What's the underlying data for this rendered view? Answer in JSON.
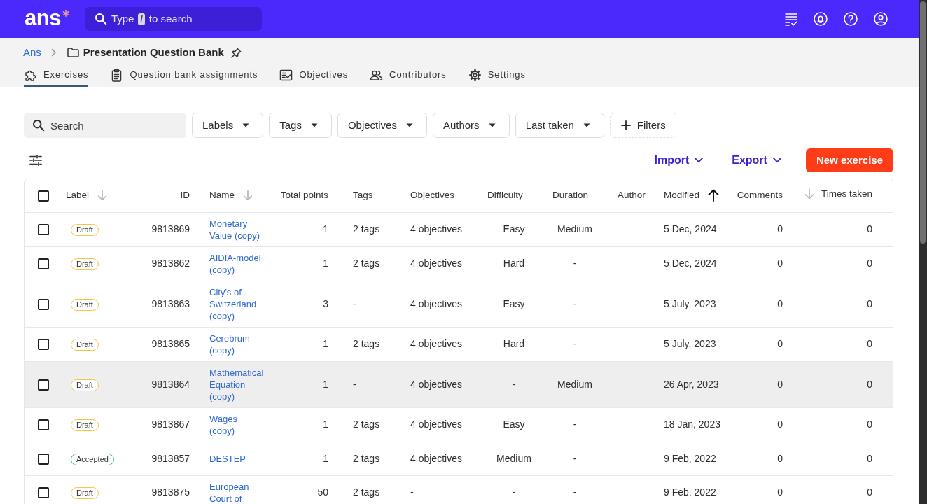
{
  "top_bar": {
    "logo": "ans",
    "search": {
      "hint_start": "Type",
      "shortcut": "/",
      "hint_end": "to search"
    }
  },
  "breadcrumb": {
    "root": "Ans",
    "current": "Presentation Question Bank"
  },
  "tabs": [
    {
      "label": "Exercises",
      "selected": true
    },
    {
      "label": "Question bank assignments",
      "selected": false
    },
    {
      "label": "Objectives",
      "selected": false
    },
    {
      "label": "Contributors",
      "selected": false
    },
    {
      "label": "Settings",
      "selected": false
    }
  ],
  "filters": {
    "search": {
      "placeholder": "Search"
    },
    "dropdowns": [
      "Labels",
      "Tags",
      "Objectives",
      "Authors",
      "Last taken"
    ],
    "add_filter": "Filters"
  },
  "actions": {
    "import": "Import",
    "export": "Export",
    "new_exercise": "New exercise"
  },
  "table": {
    "select_all": {
      "checked": false
    },
    "columns": [
      {
        "label": "Label",
        "sortable": true,
        "sorted": false
      },
      {
        "label": "ID",
        "sortable": false,
        "sorted": false
      },
      {
        "label": "Name",
        "sortable": true,
        "sorted": false
      },
      {
        "label": "Total points",
        "sortable": false,
        "sorted": false
      },
      {
        "label": "Tags",
        "sortable": false,
        "sorted": false
      },
      {
        "label": "Objectives",
        "sortable": false,
        "sorted": false
      },
      {
        "label": "Difficulty",
        "sortable": false,
        "sorted": false
      },
      {
        "label": "Duration",
        "sortable": false,
        "sorted": false
      },
      {
        "label": "Author",
        "sortable": false,
        "sorted": false
      },
      {
        "label": "Modified",
        "sortable": true,
        "sorted": true
      },
      {
        "label": "Comments",
        "sortable": false,
        "sorted": false
      },
      {
        "label": "Times taken",
        "sortable": true,
        "sorted": false
      }
    ],
    "rows": [
      {
        "checked": false,
        "hovered": false,
        "label": {
          "text": "Draft",
          "color": "#f2c744"
        },
        "id": "9813869",
        "name": "Monetary Value (copy)",
        "total_points": "1",
        "tags": "2 tags",
        "objectives": "4 objectives",
        "difficulty": "Easy",
        "duration": "Medium",
        "modified": "5 Dec, 2024",
        "comments": "0",
        "times_taken": "0"
      },
      {
        "checked": false,
        "hovered": false,
        "label": {
          "text": "Draft",
          "color": "#f2c744"
        },
        "id": "9813862",
        "name": "AIDIA-model (copy)",
        "total_points": "1",
        "tags": "2 tags",
        "objectives": "4 objectives",
        "difficulty": "Hard",
        "duration": "-",
        "modified": "5 Dec, 2024",
        "comments": "0",
        "times_taken": "0"
      },
      {
        "checked": false,
        "hovered": false,
        "label": {
          "text": "Draft",
          "color": "#f2c744"
        },
        "id": "9813863",
        "name": "City's of Switzerland (copy)",
        "total_points": "3",
        "tags": "-",
        "objectives": "4 objectives",
        "difficulty": "Easy",
        "duration": "-",
        "modified": "5 July, 2023",
        "comments": "0",
        "times_taken": "0"
      },
      {
        "checked": false,
        "hovered": false,
        "label": {
          "text": "Draft",
          "color": "#f2c744"
        },
        "id": "9813865",
        "name": "Cerebrum (copy)",
        "total_points": "1",
        "tags": "2 tags",
        "objectives": "4 objectives",
        "difficulty": "Hard",
        "duration": "-",
        "modified": "5 July, 2023",
        "comments": "0",
        "times_taken": "0"
      },
      {
        "checked": false,
        "hovered": true,
        "label": {
          "text": "Draft",
          "color": "#f2c744"
        },
        "id": "9813864",
        "name": "Mathematical Equation (copy)",
        "total_points": "1",
        "tags": "-",
        "objectives": "4 objectives",
        "difficulty": "-",
        "duration": "Medium",
        "modified": "26 Apr, 2023",
        "comments": "0",
        "times_taken": "0"
      },
      {
        "checked": false,
        "hovered": false,
        "label": {
          "text": "Draft",
          "color": "#f2c744"
        },
        "id": "9813867",
        "name": "Wages (copy)",
        "total_points": "1",
        "tags": "2 tags",
        "objectives": "4 objectives",
        "difficulty": "Easy",
        "duration": "-",
        "modified": "18 Jan, 2023",
        "comments": "0",
        "times_taken": "0"
      },
      {
        "checked": false,
        "hovered": false,
        "label": {
          "text": "Accepted",
          "color": "#3aab9b"
        },
        "id": "9813857",
        "name": "DESTEP",
        "total_points": "1",
        "tags": "2 tags",
        "objectives": "4 objectives",
        "difficulty": "Medium",
        "duration": "-",
        "modified": "9 Feb, 2022",
        "comments": "0",
        "times_taken": "0"
      },
      {
        "checked": false,
        "hovered": false,
        "label": {
          "text": "Draft",
          "color": "#f2c744"
        },
        "id": "9813875",
        "name": "European Court of",
        "total_points": "50",
        "tags": "2 tags",
        "objectives": "-",
        "difficulty": "-",
        "duration": "-",
        "modified": "9 Feb, 2022",
        "comments": "0",
        "times_taken": "0"
      }
    ]
  }
}
